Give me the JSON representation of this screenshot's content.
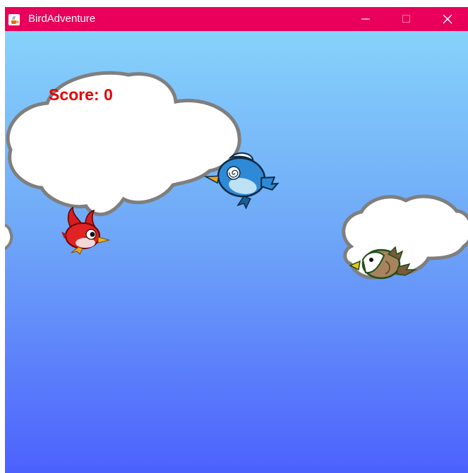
{
  "window": {
    "title": "BirdAdventure",
    "icon": "java-cup-icon",
    "controls": [
      "minimize-icon",
      "maximize-icon",
      "close-icon"
    ],
    "accent_color": "#e8005a"
  },
  "game": {
    "score_text": "Score: 0",
    "score_color": "#e60000",
    "sky_colors": [
      "#86d2fb",
      "#4c61fd"
    ],
    "sprites": {
      "player": "red-bird",
      "enemies": [
        "blue-bird",
        "eagle"
      ],
      "clouds": 3
    }
  }
}
